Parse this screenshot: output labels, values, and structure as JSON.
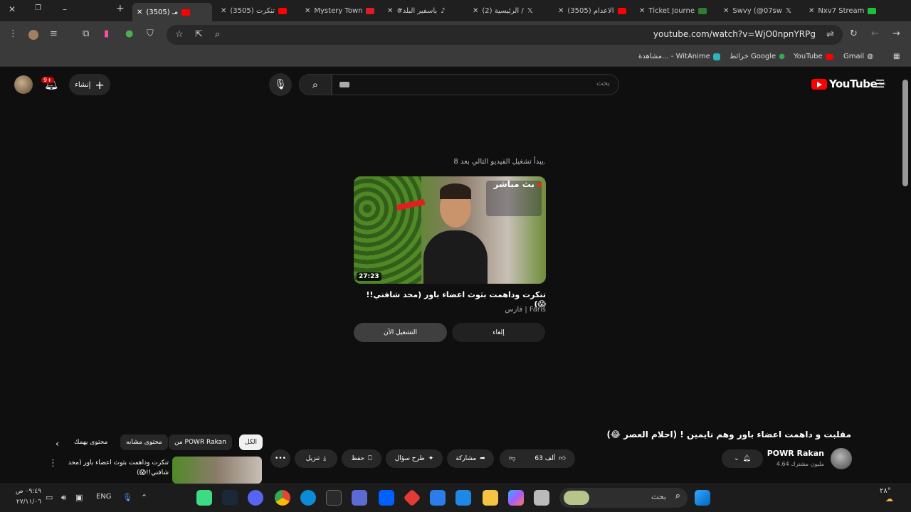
{
  "browser": {
    "tabs": [
      {
        "label": "(3505) مـ",
        "color": "#ff0000",
        "active": true
      },
      {
        "label": "(3505) تنكرت",
        "color": "#ff0000"
      },
      {
        "label": "Mystery Town",
        "color": "#e01b24"
      },
      {
        "label": "#باسفير البلد",
        "color": "#111111"
      },
      {
        "label": "(2) الرئيسية /",
        "color": "#111111"
      },
      {
        "label": "(3505) الاعدام",
        "color": "#ff0000"
      },
      {
        "label": "Ticket Journe",
        "color": "#2f7d32"
      },
      {
        "label": "Swvy (@07sw",
        "color": "#111111"
      },
      {
        "label": "Nxv7 Stream",
        "color": "#1fbf3a"
      }
    ],
    "url": "youtube.com/watch?v=WjO0npnYRPg",
    "bookmarks": [
      "Gmail",
      "YouTube",
      "خرائط Google",
      "مشاهدة... - WitAnime"
    ]
  },
  "youtube": {
    "logo_text": "YouTube",
    "region": "SA",
    "search_placeholder": "بحث",
    "create_label": "إنشاء",
    "notification_badge": "9+"
  },
  "endscreen": {
    "up_next_text": "يبدأ تشغيل الفيديو التالي بعد 8.",
    "live_label": "بث مباشر",
    "duration": "27:23",
    "title": "تنكرت وداهمت بثوث اعضاء باور (محد شافني!! 😱)",
    "channel": "فارس | Faris",
    "play_now": "التشغيل الآن",
    "cancel": "إلغاء"
  },
  "video": {
    "title": "مقلبت و داهمت اعضاء باور وهم نايمين ! (احلام العصر 😂)",
    "channel": "POWR Rakan",
    "subscribers": "4.64 مليون مشترك",
    "likes": "63 ألف",
    "share": "مشاركة",
    "ask": "طرح سؤال",
    "save": "حفظ",
    "download": "تنزيل"
  },
  "chips": [
    "الكل",
    "من POWR Rakan",
    "محتوى مشابه",
    "محتوى يهمك"
  ],
  "related": {
    "title": "تنكرت وداهمت بثوث اعضاء باور (محد شافني!!😱)"
  },
  "taskbar": {
    "search_label": "بحث",
    "lang": "ENG",
    "time": "٠٩:٤٩ ص",
    "date": "٢٧/١١/٠٦",
    "temp": "٢٨°"
  }
}
